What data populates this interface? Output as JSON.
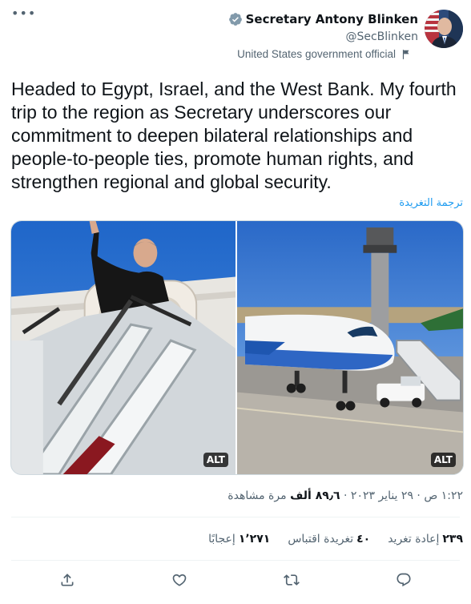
{
  "author": {
    "display_name": "Secretary Antony Blinken",
    "handle": "@SecBlinken",
    "label": "United States government official"
  },
  "tweet": {
    "text": "Headed to Egypt, Israel, and the West Bank. My fourth trip to the region as Secretary underscores our commitment to deepen bilateral relationships and people-to-people ties, promote human rights, and strengthen regional and global security.",
    "translate_label": "ترجمة التغريدة"
  },
  "media": {
    "photos": [
      {
        "alt_badge": "ALT"
      },
      {
        "alt_badge": "ALT"
      }
    ]
  },
  "meta": {
    "time": "١:٢٢ ص",
    "date": "٢٩ يناير ٢٠٢٣",
    "views_count": "٨٩٫٦ ألف",
    "views_label": "مرة مشاهدة"
  },
  "stats": {
    "retweets_count": "٢٣٩",
    "retweets_label": "إعادة تغريد",
    "quotes_count": "٤٠",
    "quotes_label": "تغريدة اقتباس",
    "likes_count": "١٬٢٧١",
    "likes_label": "إعجابًا"
  },
  "icons": {
    "more": "more-horizontal-icon",
    "verified": "verified-badge-icon",
    "flag": "flag-icon",
    "share": "share-icon",
    "like": "heart-icon",
    "retweet": "retweet-icon",
    "reply": "reply-icon"
  },
  "colors": {
    "accent": "#1d9bf0",
    "secondary_text": "#536471",
    "badge_gray": "#829aab"
  }
}
